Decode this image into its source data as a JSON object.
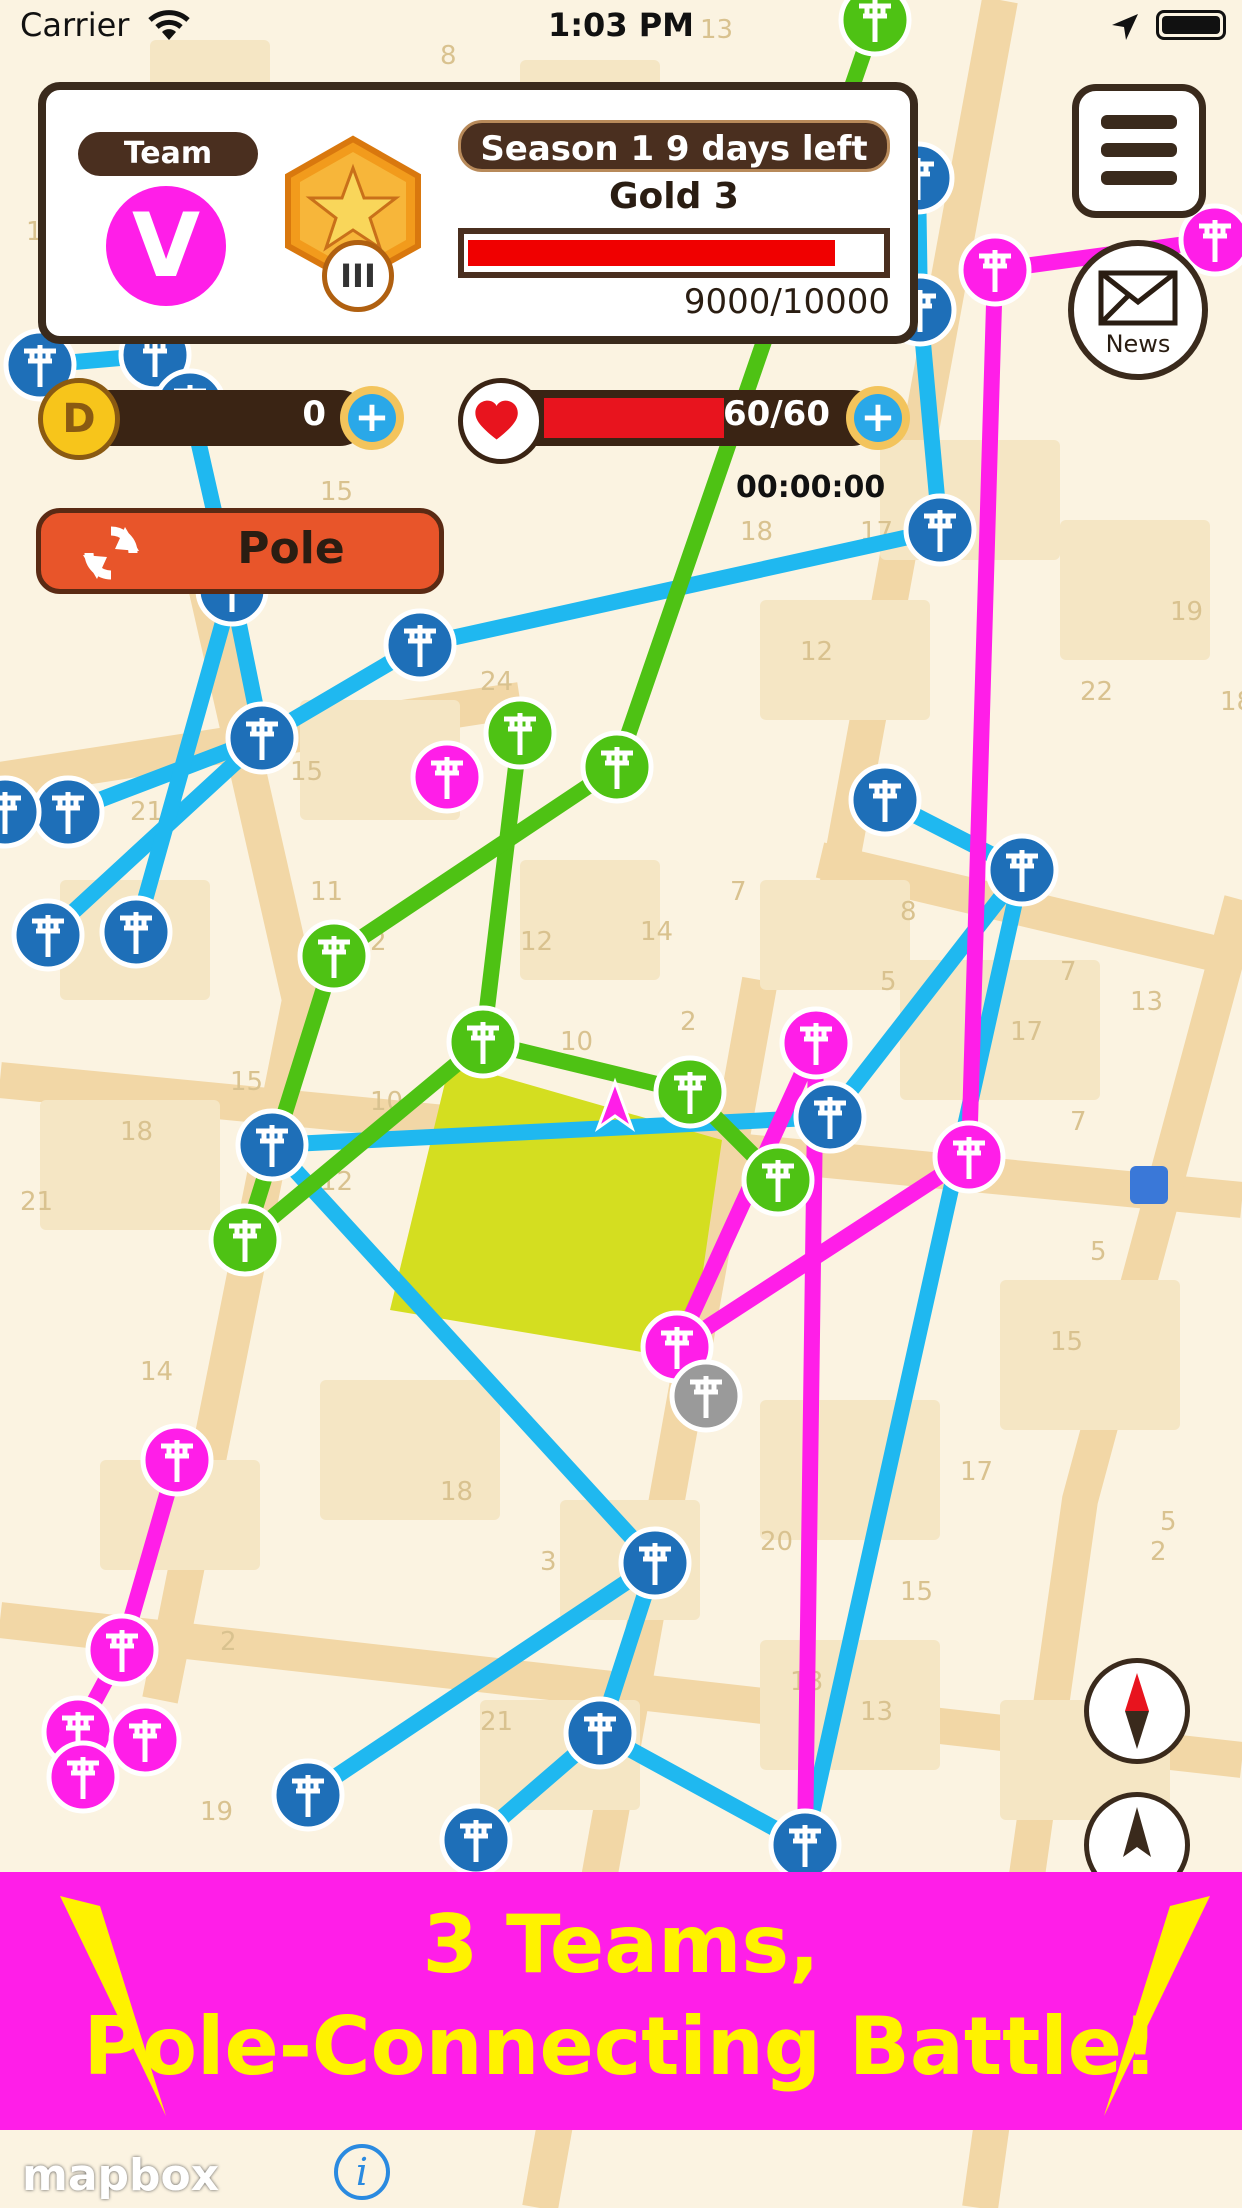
{
  "status_bar": {
    "carrier": "Carrier",
    "time": "1:03 PM"
  },
  "team": {
    "label": "Team",
    "letter": "V",
    "color": "#ff1ee8"
  },
  "rank": {
    "season": "Season 1 9 days left",
    "name": "Gold 3",
    "level": "III",
    "xp_text": "9000/10000",
    "xp_fraction": 0.9
  },
  "coins": {
    "icon_letter": "D",
    "value": "0"
  },
  "stamina": {
    "value": "60/60",
    "fraction": 1.0,
    "timer": "00:00:00"
  },
  "pole_button": {
    "label": "Pole"
  },
  "news_button": {
    "label": "News"
  },
  "promo": {
    "line1": "3 Teams,",
    "line2": "Pole-Connecting Battle!"
  },
  "map": {
    "attribution": "mapbox",
    "team_colors": {
      "blue": "#1e6fb8",
      "green": "#4ec214",
      "magenta": "#ff1ee8",
      "neutral": "#9a9a9a"
    },
    "block_numbers": [
      "8",
      "13",
      "13",
      "17",
      "15",
      "18",
      "17",
      "12",
      "19",
      "22",
      "18",
      "24",
      "15",
      "21",
      "11",
      "2",
      "7",
      "12",
      "14",
      "8",
      "10",
      "2",
      "5",
      "7",
      "13",
      "17",
      "15",
      "10",
      "12",
      "7",
      "18",
      "5",
      "21",
      "14",
      "15",
      "17",
      "18",
      "3",
      "20",
      "15",
      "5",
      "2",
      "2",
      "21",
      "18",
      "13",
      "19"
    ]
  },
  "colors": {
    "panel_border": "#3a2a1c",
    "banner": "#ff1ee8",
    "banner_text": "#fff200",
    "bar_red": "#f00000"
  }
}
